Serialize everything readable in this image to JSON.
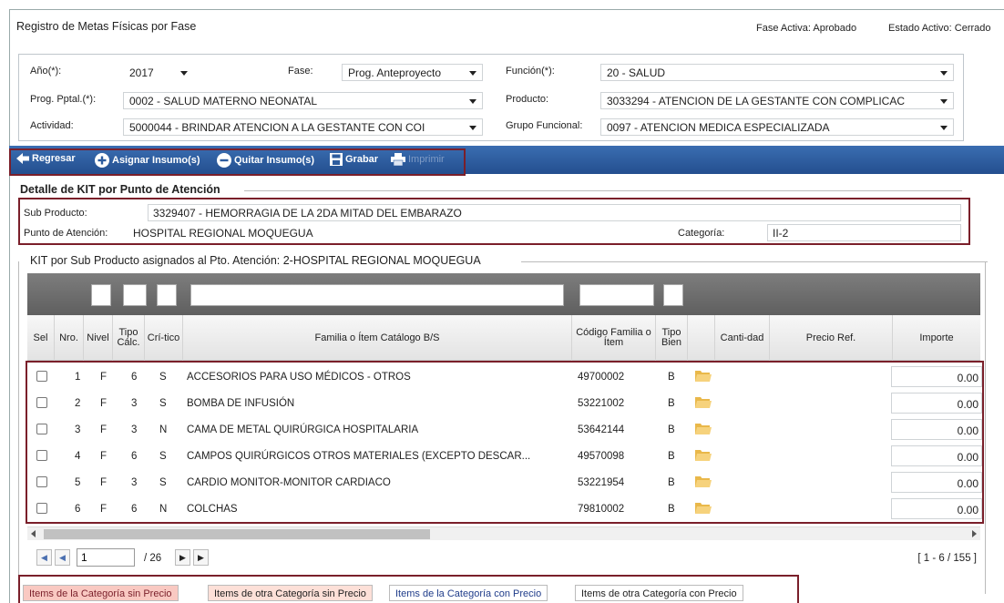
{
  "header": {
    "title": "Registro de Metas Físicas por Fase",
    "fase_activa": "Fase Activa: Aprobado",
    "estado_activo": "Estado Activo: Cerrado"
  },
  "filters": {
    "anio_label": "Año(*):",
    "anio_value": "2017",
    "fase_label": "Fase:",
    "fase_value": "Prog. Anteproyecto",
    "funcion_label": "Función(*):",
    "funcion_value": "20 - SALUD",
    "prog_label": "Prog. Pptal.(*):",
    "prog_value": "0002 - SALUD MATERNO NEONATAL",
    "producto_label": "Producto:",
    "producto_value": "3033294 - ATENCION DE LA GESTANTE CON COMPLICAC",
    "actividad_label": "Actividad:",
    "actividad_value": "5000044 - BRINDAR ATENCION A LA GESTANTE CON COI",
    "grupo_label": "Grupo Funcional:",
    "grupo_value": "0097 - ATENCION MEDICA ESPECIALIZADA"
  },
  "toolbar": {
    "regresar": "Regresar",
    "asignar": "Asignar Insumo(s)",
    "quitar": "Quitar Insumo(s)",
    "grabar": "Grabar",
    "imprimir": "Imprimir"
  },
  "detalle": {
    "legend": "Detalle de KIT por Punto de Atención",
    "subproducto_label": "Sub Producto:",
    "subproducto_value": "3329407 - HEMORRAGIA DE LA 2DA MITAD DEL EMBARAZO",
    "punto_label": "Punto de Atención:",
    "punto_value": "HOSPITAL REGIONAL MOQUEGUA",
    "categoria_label": "Categoría:",
    "categoria_value": "II-2"
  },
  "grid": {
    "legend": "KIT por Sub Producto asignados al Pto. Atención: 2-HOSPITAL REGIONAL MOQUEGUA",
    "columns": {
      "sel": "Sel",
      "nro": "Nro.",
      "nivel": "Nivel",
      "tipo_calc": "Tipo Cálc.",
      "critico": "Crí-tico",
      "familia": "Familia o Ítem Catálogo B/S",
      "codigo": "Código Familia o Ítem",
      "tipo_bien": "Tipo Bien",
      "cantidad": "Canti-dad",
      "precio": "Precio Ref.",
      "importe": "Importe"
    },
    "rows": [
      {
        "nro": "1",
        "nivel": "F",
        "tipo": "6",
        "critico": "S",
        "familia": "ACCESORIOS PARA USO MÉDICOS - OTROS",
        "codigo": "49700002",
        "bien": "B",
        "importe": "0.00"
      },
      {
        "nro": "2",
        "nivel": "F",
        "tipo": "3",
        "critico": "S",
        "familia": "BOMBA DE INFUSIÓN",
        "codigo": "53221002",
        "bien": "B",
        "importe": "0.00"
      },
      {
        "nro": "3",
        "nivel": "F",
        "tipo": "3",
        "critico": "N",
        "familia": "CAMA DE METAL QUIRÚRGICA HOSPITALARIA",
        "codigo": "53642144",
        "bien": "B",
        "importe": "0.00"
      },
      {
        "nro": "4",
        "nivel": "F",
        "tipo": "6",
        "critico": "S",
        "familia": "CAMPOS QUIRÚRGICOS OTROS MATERIALES (EXCEPTO DESCAR...",
        "codigo": "49570098",
        "bien": "B",
        "importe": "0.00"
      },
      {
        "nro": "5",
        "nivel": "F",
        "tipo": "3",
        "critico": "S",
        "familia": "CARDIO MONITOR-MONITOR CARDIACO",
        "codigo": "53221954",
        "bien": "B",
        "importe": "0.00"
      },
      {
        "nro": "6",
        "nivel": "F",
        "tipo": "6",
        "critico": "N",
        "familia": "COLCHAS",
        "codigo": "79810002",
        "bien": "B",
        "importe": "0.00"
      }
    ]
  },
  "pager": {
    "page_value": "1",
    "total_pages": "/ 26",
    "info": "[ 1 - 6 / 155 ]"
  },
  "categories": {
    "cat1": "Items de la Categoría sin Precio",
    "cat2": "Items de otra Categoría sin Precio",
    "cat3": "Items de la Categoría con Precio",
    "cat4": "Items de otra Categoría con Precio",
    "colors": {
      "cat1": "#f9c9c2",
      "cat2": "#fde0d8",
      "cat3": "#ffffff",
      "cat4": "#ffffff",
      "cat1_text": "#7a1f2a",
      "cat3_text": "#1f3c8a"
    }
  },
  "accent": {
    "toolbar": "#2d5c9e",
    "outline": "#7a1f2a"
  }
}
